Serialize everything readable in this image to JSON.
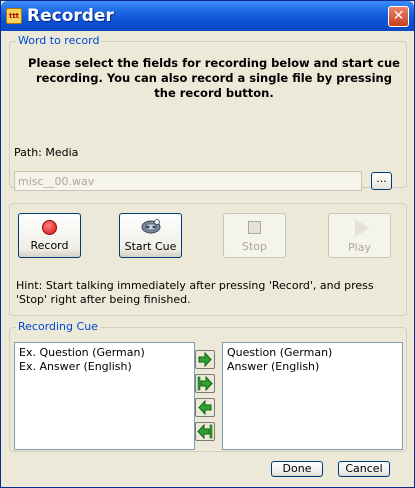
{
  "window": {
    "title": "Recorder",
    "app_icon_text": "ttt"
  },
  "word_group": {
    "label": "Word to record",
    "instructions": "Please select the fields for recording below and start cue recording. You can also record a single file by pressing the record button.",
    "path_label": "Path: Media",
    "file_value": "misc__00.wav",
    "browse_label": "..."
  },
  "transport": {
    "record": "Record",
    "start_cue": "Start Cue",
    "stop": "Stop",
    "play": "Play",
    "hint": "Hint: Start talking immediately after pressing 'Record', and press 'Stop' right after being finished."
  },
  "cue_group": {
    "label": "Recording Cue",
    "available": [
      "Ex. Question (German)",
      "Ex. Answer (English)"
    ],
    "selected": [
      "Question (German)",
      "Answer (English)"
    ]
  },
  "footer": {
    "done": "Done",
    "cancel": "Cancel"
  },
  "colors": {
    "title_bar": "#0a4fd4",
    "group_label": "#0046d5",
    "arrow_green": "#2ea42e"
  }
}
